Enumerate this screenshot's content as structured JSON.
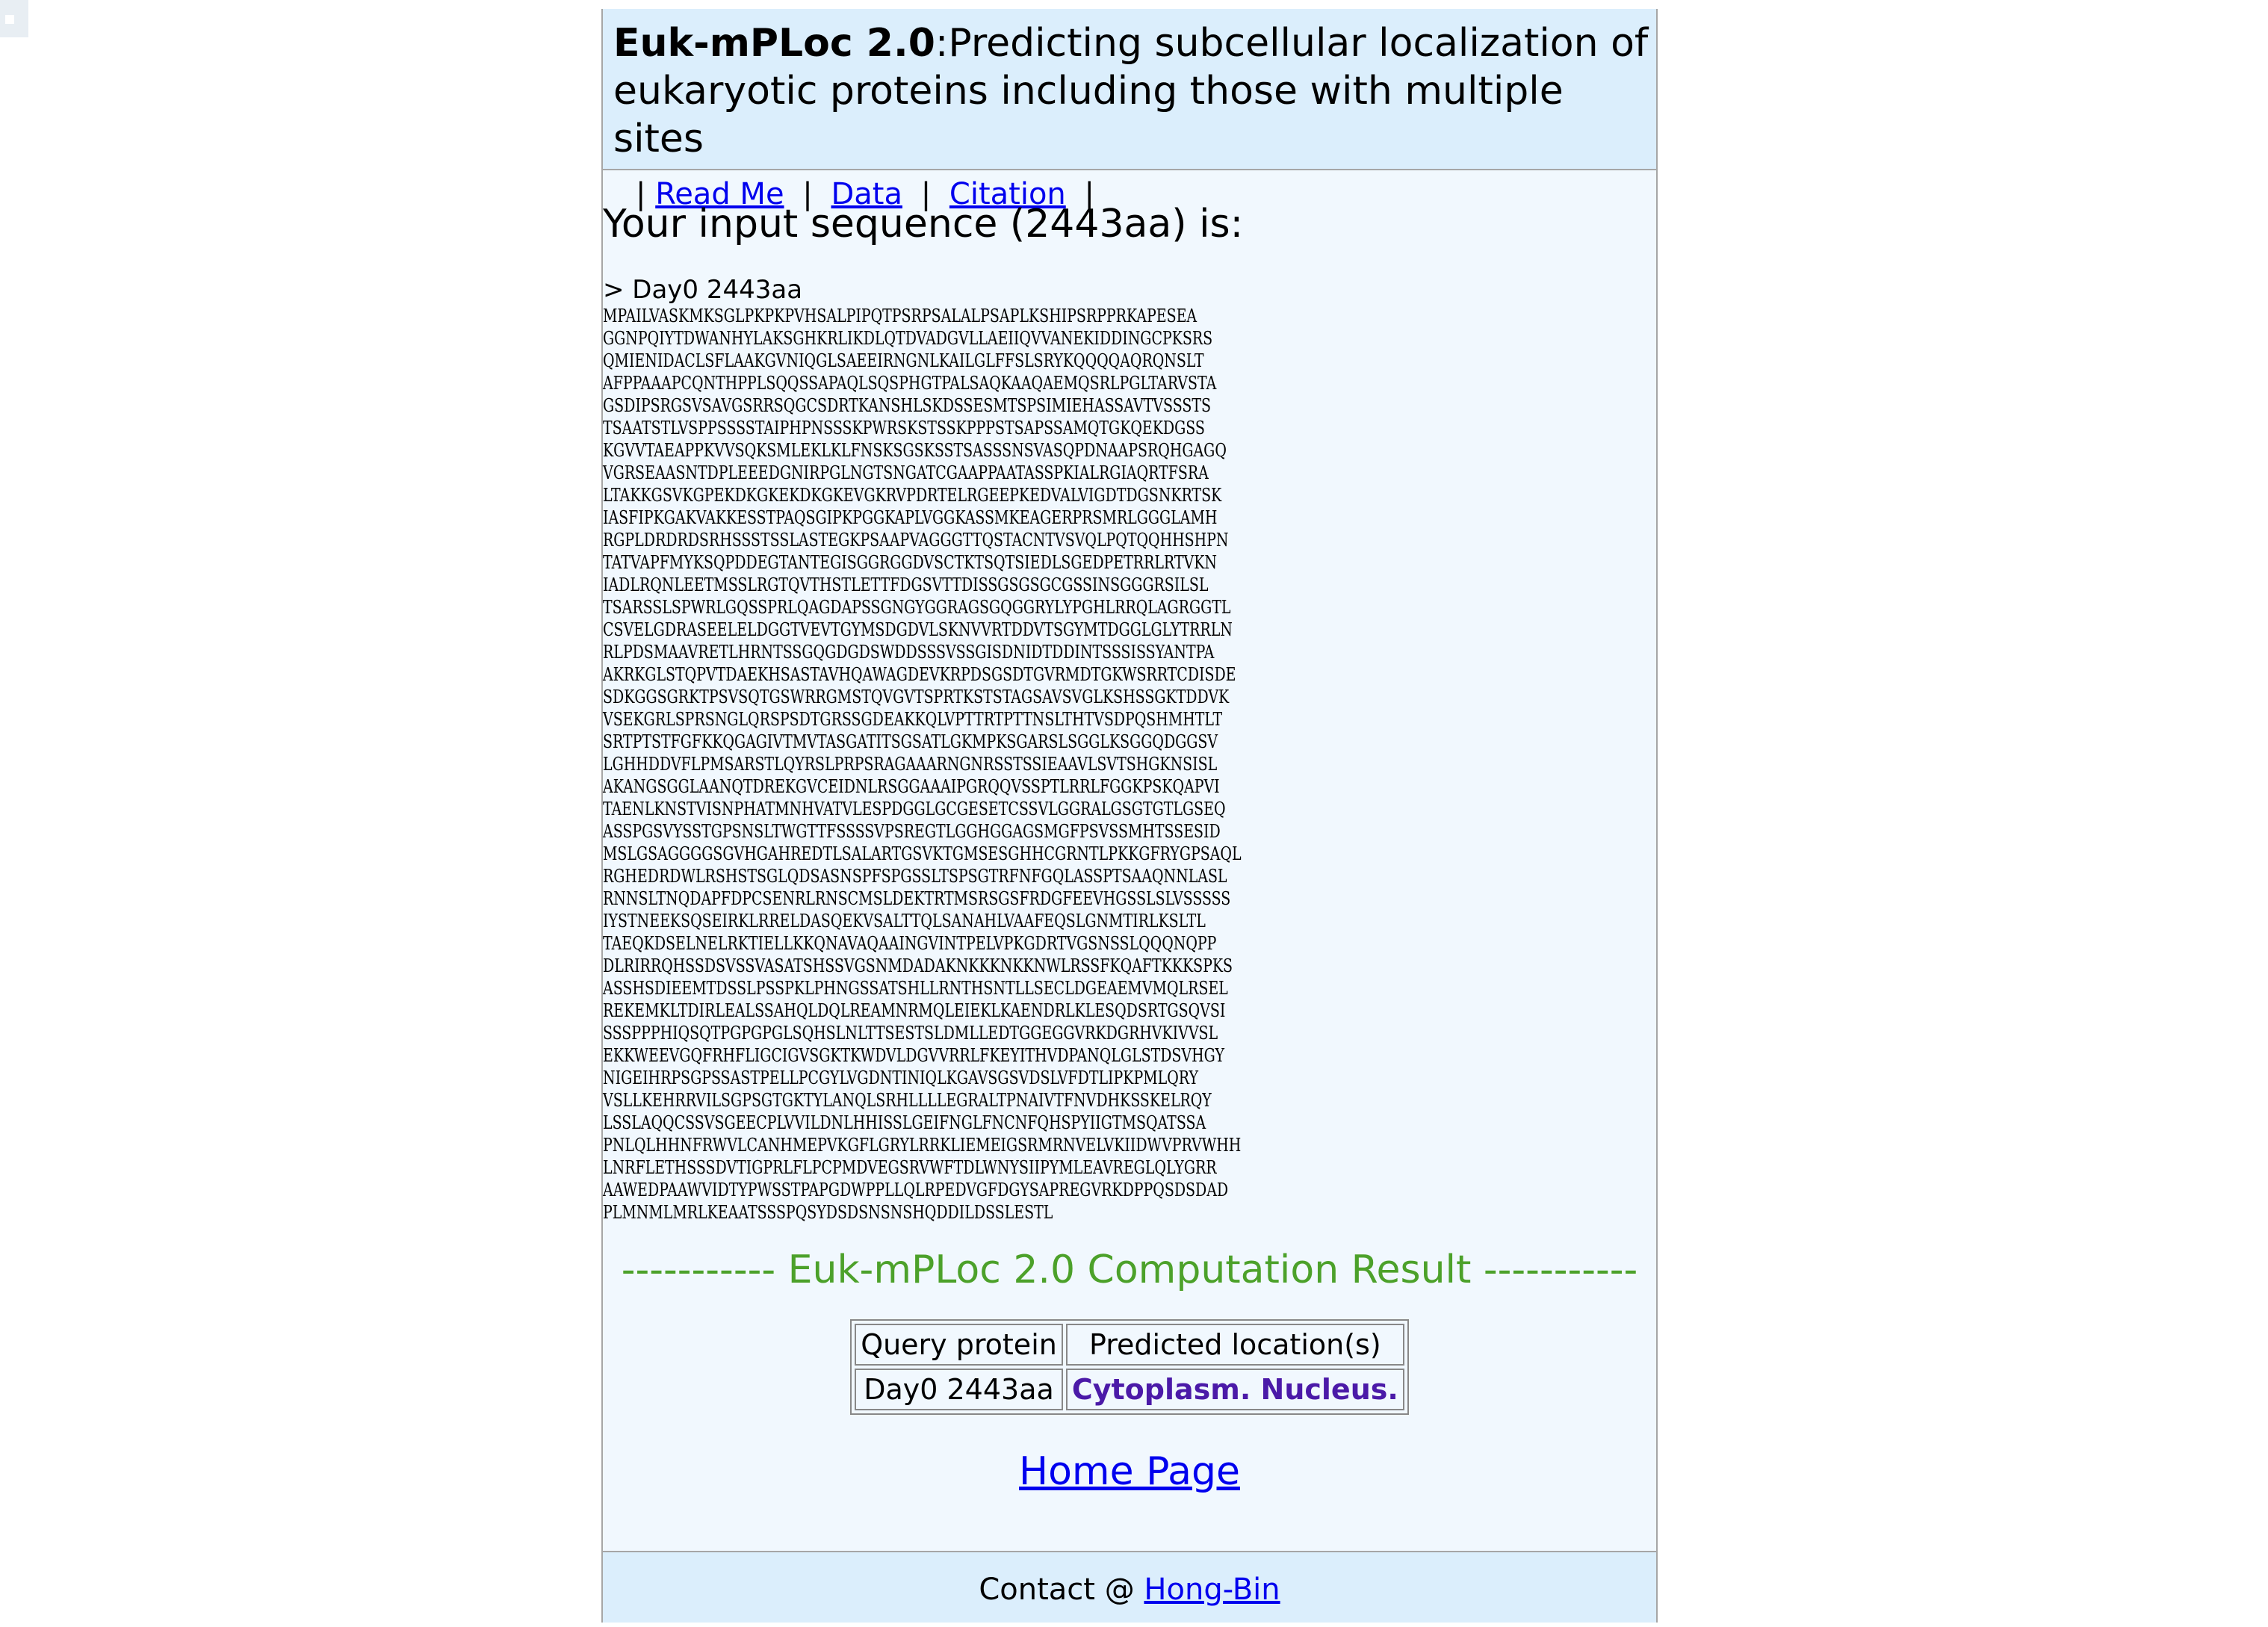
{
  "header": {
    "brand": "Euk-mPLoc 2.0",
    "subtitle": ":Predicting subcellular localization of eukaryotic proteins including those with multiple sites",
    "nav": {
      "sep": "|",
      "read_me": "Read Me",
      "data": "Data",
      "citation": "Citation"
    }
  },
  "main": {
    "heading": "Your input sequence (2443aa) is:",
    "fasta_header": "> Day0 2443aa",
    "sequence_lines": [
      "MPAILVASKMKSGLPKPKPVHSALPIPQTPSRPSALALPSAPLKSHIPSRPPRKAPESEA",
      "GGNPQIYTDWANHYLAKSGHKRLIKDLQTDVADGVLLAEIIQVVANEKIDDINGCPKSRS",
      "QMIENIDACLSFLAAKGVNIQGLSAEEIRNGNLKAILGLFFSLSRYKQQQQAQRQNSLT",
      "AFPPAAAPCQNTHPPLSQQSSAPAQLSQSPHGTPALSAQKAAQAEMQSRLPGLTARVSTA",
      "GSDIPSRGSVSAVGSRRSQGCSDRTKANSHLSKDSSESMTSPSIMIEHASSAVTVSSSTS",
      "TSAATSTLVSPPSSSSTAIPHPNSSSKPWRSKSTSSKPPPSTSAPSSAMQTGKQEKDGSS",
      "KGVVTAEAPPKVVSQKSMLEKLKLFNSKSGSKSSTSASSSNSVASQPDNAAPSRQHGAGQ",
      "VGRSEAASNTDPLEEEDGNIRPGLNGTSNGATCGAAPPAATASSPKIALRGIAQRTFSRA",
      "LTAKKGSVKGPEKDKGKEKDKGKEVGKRVPDRTELRGEEPKEDVALVIGDTDGSNKRTSK",
      "IASFIPKGAKVAKKESSTPAQSGIPKPGGKAPLVGGKASSMKEAGERPRSMRLGGGLAMH",
      "RGPLDRDRDSRHSSSTSSLASTEGKPSAAPVAGGGTTQSTACNTVSVQLPQTQQHHSHPN",
      "TATVAPFMYKSQPDDEGTANTEGISGGRGGDVSCTKTSQTSIEDLSGEDPETRRLRTVKN",
      "IADLRQNLEETMSSLRGTQVTHSTLETTFDGSVTTDISSGSGSGCGSSINSGGGRSILSL",
      "TSARSSLSPWRLGQSSPRLQAGDAPSSGNGYGGRAGSGQGGRYLYPGHLRRQLAGRGGTL",
      "CSVELGDRASEELELDGGTVEVTGYMSDGDVLSKNVVRTDDVTSGYMTDGGLGLYTRRLN",
      "RLPDSMAAVRETLHRNTSSGQGDGDSWDDSSSVSSGISDNIDTDDINTSSSISSYANTPA",
      "AKRKGLSTQPVTDAEKHSASTAVHQAWAGDEVKRPDSGSDTGVRMDTGKWSRRTCDISDE",
      "SDKGGSGRKTPSVSQTGSWRRGMSTQVGVTSPRTKSTSTAGSAVSVGLKSHSSGKTDDVK",
      "VSEKGRLSPRSNGLQRSPSDTGRSSGDEAKKQLVPTTRTPTTNSLTHTVSDPQSHMHTLT",
      "SRTPTSTFGFKKQGAGIVTMVTASGATITSGSATLGKMPKSGARSLSGGLKSGGQDGGSV",
      "LGHHDDVFLPMSARSTLQYRSLPRPSRAGAAARNGNRSSTSSIEAAVLSVTSHGKNSISL",
      "AKANGSGGLAANQTDREKGVCEIDNLRSGGAAAIPGRQQVSSPTLRRLFGGKPSKQAPVI",
      "TAENLKNSTVISNPHATMNHVATVLESPDGGLGCGESETCSSVLGGRALGSGTGTLGSEQ",
      "ASSPGSVYSSTGPSNSLTWGTTFSSSSVPSREGTLGGHGGAGSMGFPSVSSMHTSSESID",
      "MSLGSAGGGGSGVHGAHREDTLSALARTGSVKTGMSESGHHCGRNTLPKKGFRYGPSAQL",
      "RGHEDRDWLRSHSTSGLQDSASNSPFSPGSSLTSPSGTRFNFGQLASSPTSAAQNNLASL",
      "RNNSLTNQDAPFDPCSENRLRNSCMSLDEKTRTMSRSGSFRDGFEEVHGSSLSLVSSSSS",
      "IYSTNEEKSQSEIRKLRRELDASQEKVSALTTQLSANAHLVAAFEQSLGNMTIRLKSLTL",
      "TAEQKDSELNELRKTIELLKKQNAVAQAAINGVINTPELVPKGDRTVGSNSSLQQQNQPP",
      "DLRIRRQHSSDSVSSVASATSHSSVGSNMDADAKNKKKNKKNWLRSSFKQAFTKKKSPKS",
      "ASSHSDIEEMTDSSLPSSPKLPHNGSSATSHLLRNTHSNTLLSECLDGEAEMVMQLRSEL",
      "REKEMKLTDIRLEALSSAHQLDQLREAMNRMQLEIEKLKAENDRLKLESQDSRTGSQVSI",
      "SSSPPPHIQSQTPGPGPGLSQHSLNLTTSESTSLDMLLEDTGGEGGVRKDGRHVKIVVSL",
      "EKKWEEVGQFRHFLIGCIGVSGKTKWDVLDGVVRRLFKEYITHVDPANQLGLSTDSVHGY",
      "NIGEIHRPSGPSSASTPELLPCGYLVGDNTINIQLKGAVSGSVDSLVFDTLIPKPMLQRY",
      "VSLLKEHRRVILSGPSGTGKTYLANQLSRHLLLLEGRALTPNAIVTFNVDHKSSKELRQY",
      "LSSLAQQCSSVSGEECPLVVILDNLHHISSLGEIFNGLFNCNFQHSPYIIGTMSQATSSA",
      "PNLQLHHNFRWVLCANHMEPVKGFLGRYLRRKLIEMEIGSRMRNVELVKIIDWVPRVWHH",
      "LNRFLETHSSSDVTIGPRLFLPCPMDVEGSRVWFTDLWNYSIIPYMLEAVREGLQLYGRR",
      "AAWEDPAAWVIDTYPWSSTPAPGDWPPLLQLRPEDVGFDGYSAPREGVRKDPPQSDSDAD",
      "PLMNMLMRLKEAATSSSPQSYDSDSNSNSHQDDILDSSLESTL"
    ],
    "result_title": "----------- Euk-mPLoc 2.0 Computation Result -----------",
    "result_table": {
      "headers": [
        "Query protein",
        "Predicted location(s)"
      ],
      "rows": [
        [
          "Day0 2443aa",
          "Cytoplasm. Nucleus."
        ]
      ]
    },
    "home_link": "Home Page"
  },
  "footer": {
    "contact_prefix": "Contact @ ",
    "contact_link": "Hong-Bin"
  },
  "colors": {
    "result_title": "#4ca12a",
    "location_text": "#4b1aa8",
    "header_bg": "#dbeefc",
    "page_bg": "#f1f8fe",
    "link": "#0000ee"
  }
}
